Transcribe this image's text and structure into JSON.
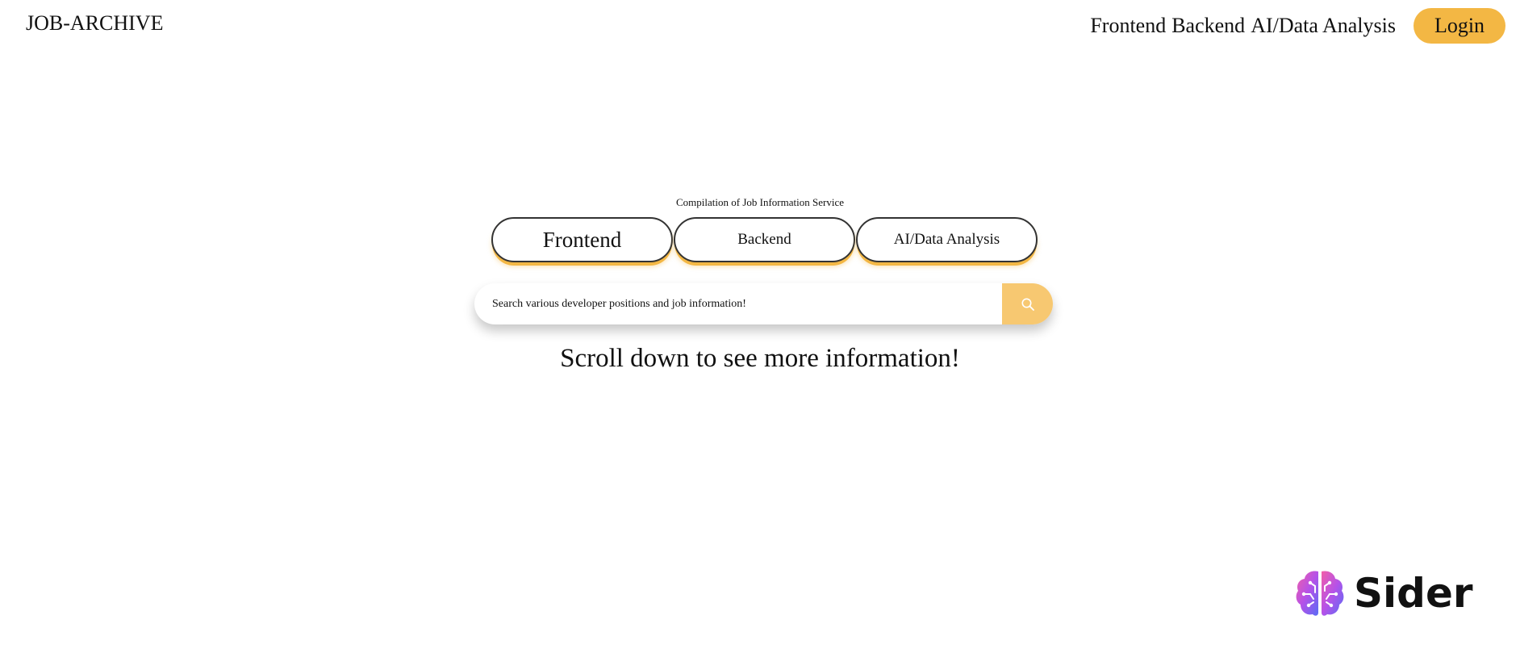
{
  "header": {
    "logo": "JOB-ARCHIVE",
    "nav": [
      "Frontend",
      "Backend",
      "AI/Data Analysis"
    ],
    "login_label": "Login"
  },
  "hero": {
    "subtitle": "Compilation of Job Information Service",
    "categories": [
      {
        "label": "Frontend",
        "active": true
      },
      {
        "label": "Backend",
        "active": false
      },
      {
        "label": "AI/Data Analysis",
        "active": false
      }
    ],
    "search": {
      "placeholder": "Search various developer positions and job information!",
      "button_icon": "search-icon"
    },
    "scroll_message": "Scroll down to see more information!"
  },
  "watermark": {
    "text": "Sider",
    "icon": "brain-icon"
  },
  "colors": {
    "accent": "#f3b744",
    "search_button": "#f7c871",
    "outline": "#333333"
  }
}
